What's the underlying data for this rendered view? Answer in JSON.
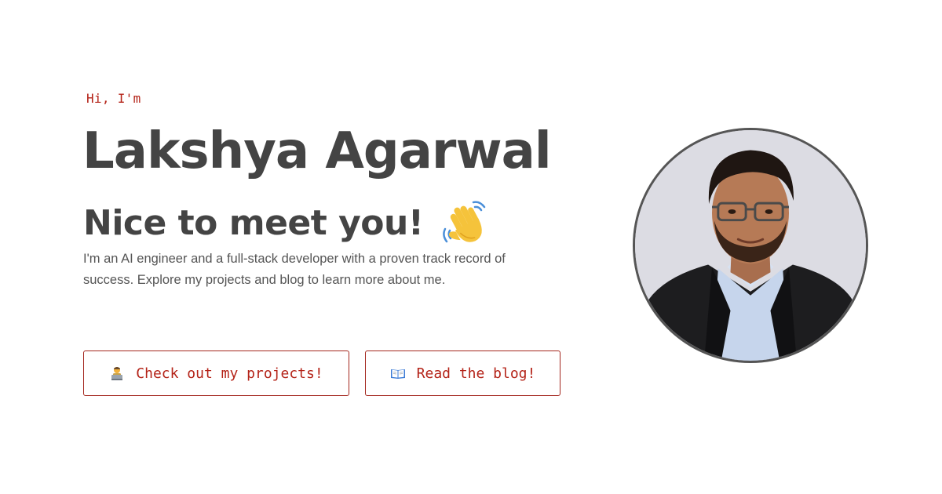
{
  "hero": {
    "greeting": "Hi, I'm",
    "name": "Lakshya Agarwal",
    "subtitle": "Nice to meet you!",
    "subtitle_icon": "waving-hand-icon",
    "bio": "I'm an AI engineer and a full-stack developer with a proven track record of success. Explore my projects and blog to learn more about me."
  },
  "buttons": {
    "projects": {
      "label": "Check out my projects!",
      "icon": "technologist-icon"
    },
    "blog": {
      "label": "Read the blog!",
      "icon": "open-book-icon"
    }
  },
  "profile": {
    "photo_alt": "Lakshya Agarwal"
  },
  "colors": {
    "accent": "#b42318",
    "heading": "#444444",
    "body_text": "#555555",
    "background": "#ffffff"
  }
}
